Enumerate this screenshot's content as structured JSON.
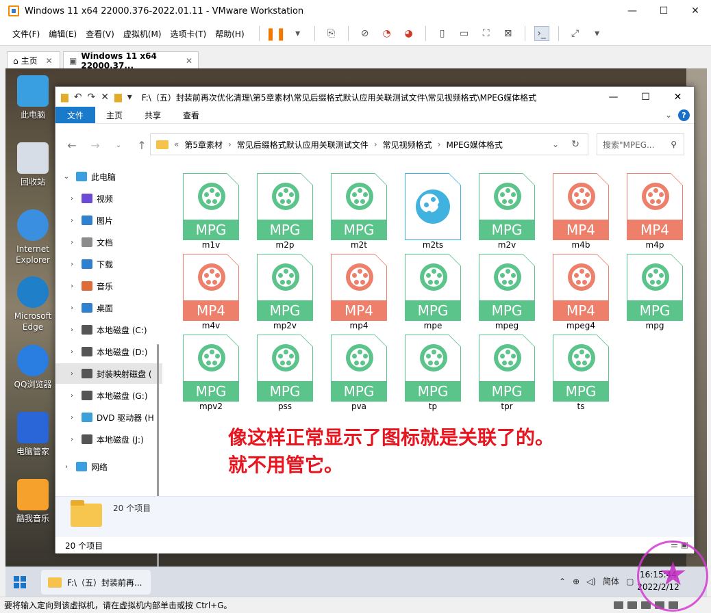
{
  "vm": {
    "title": "Windows 11 x64 22000.376-2022.01.11 - VMware Workstation",
    "menu": [
      "文件(F)",
      "编辑(E)",
      "查看(V)",
      "虚拟机(M)",
      "选项卡(T)",
      "帮助(H)"
    ],
    "tabs": [
      {
        "label": "主页"
      },
      {
        "label": "Windows 11 x64 22000.37..."
      }
    ],
    "status": "要将输入定向到该虚拟机，请在虚拟机内部单击或按 Ctrl+G。",
    "win_min": "—",
    "win_max": "☐",
    "win_close": "✕"
  },
  "desktop_icons": [
    {
      "label": "此电脑",
      "color": "#3a9fe0"
    },
    {
      "label": "回收站",
      "color": "#d6dde6"
    },
    {
      "label": "Internet Explorer",
      "color": "#3b8fe0"
    },
    {
      "label": "Microsoft Edge",
      "color": "#1f7fc9"
    },
    {
      "label": "QQ浏览器",
      "color": "#2a7de1"
    },
    {
      "label": "电脑管家",
      "color": "#2a66d8"
    },
    {
      "label": "酷我音乐",
      "color": "#f6a12b"
    }
  ],
  "explorer": {
    "path": "F:\\（五）封装前再次优化清理\\第5章素材\\常见后缀格式默认应用关联测试文件\\常见视频格式\\MPEG媒体格式",
    "ribbon": [
      "文件",
      "主页",
      "共享",
      "查看"
    ],
    "breadcrumb": [
      "第5章素材",
      "常见后缀格式默认应用关联测试文件",
      "常见视频格式",
      "MPEG媒体格式"
    ],
    "breadcrumb_prefix": "«",
    "search_placeholder": "搜索\"MPEG...",
    "sidebar": [
      {
        "label": "此电脑",
        "expanded": true,
        "level": 0
      },
      {
        "label": "视频",
        "level": 1
      },
      {
        "label": "图片",
        "level": 1
      },
      {
        "label": "文档",
        "level": 1
      },
      {
        "label": "下载",
        "level": 1
      },
      {
        "label": "音乐",
        "level": 1
      },
      {
        "label": "桌面",
        "level": 1
      },
      {
        "label": "本地磁盘 (C:)",
        "level": 1
      },
      {
        "label": "本地磁盘 (D:)",
        "level": 1
      },
      {
        "label": "封装映射磁盘 (",
        "level": 1,
        "selected": true
      },
      {
        "label": "本地磁盘 (G:)",
        "level": 1
      },
      {
        "label": "DVD 驱动器 (H",
        "level": 1
      },
      {
        "label": "本地磁盘 (J:)",
        "level": 1
      },
      {
        "label": "网络",
        "level": 0
      }
    ],
    "files": [
      {
        "name": "m1v",
        "badge": "MPG",
        "kind": "mpg"
      },
      {
        "name": "m2p",
        "badge": "MPG",
        "kind": "mpg"
      },
      {
        "name": "m2t",
        "badge": "MPG",
        "kind": "mpg"
      },
      {
        "name": "m2ts",
        "badge": "",
        "kind": "blue"
      },
      {
        "name": "m2v",
        "badge": "MPG",
        "kind": "mpg"
      },
      {
        "name": "m4b",
        "badge": "MP4",
        "kind": "mp4"
      },
      {
        "name": "m4p",
        "badge": "MP4",
        "kind": "mp4"
      },
      {
        "name": "m4v",
        "badge": "MP4",
        "kind": "mp4"
      },
      {
        "name": "mp2v",
        "badge": "MPG",
        "kind": "mpg"
      },
      {
        "name": "mp4",
        "badge": "MP4",
        "kind": "mp4"
      },
      {
        "name": "mpe",
        "badge": "MPG",
        "kind": "mpg"
      },
      {
        "name": "mpeg",
        "badge": "MPG",
        "kind": "mpg"
      },
      {
        "name": "mpeg4",
        "badge": "MP4",
        "kind": "mp4"
      },
      {
        "name": "mpg",
        "badge": "MPG",
        "kind": "mpg"
      },
      {
        "name": "mpv2",
        "badge": "MPG",
        "kind": "mpg"
      },
      {
        "name": "pss",
        "badge": "MPG",
        "kind": "mpg"
      },
      {
        "name": "pva",
        "badge": "MPG",
        "kind": "mpg"
      },
      {
        "name": "tp",
        "badge": "MPG",
        "kind": "mpg"
      },
      {
        "name": "tpr",
        "badge": "MPG",
        "kind": "mpg"
      },
      {
        "name": "ts",
        "badge": "MPG",
        "kind": "mpg"
      }
    ],
    "details_count": "20 个项目",
    "status_count": "20 个项目"
  },
  "colors": {
    "mpg": "#5ac48a",
    "mp4": "#ee7f6a",
    "blue": "#3fb2e0"
  },
  "overlay": {
    "line1": "像这样正常显示了图标就是关联了的。",
    "line2": "就不用管它。"
  },
  "taskbar": {
    "app_label": "F:\\（五）封装前再...",
    "ime": "简体",
    "time": "16:15:44",
    "date": "2022/2/12"
  }
}
